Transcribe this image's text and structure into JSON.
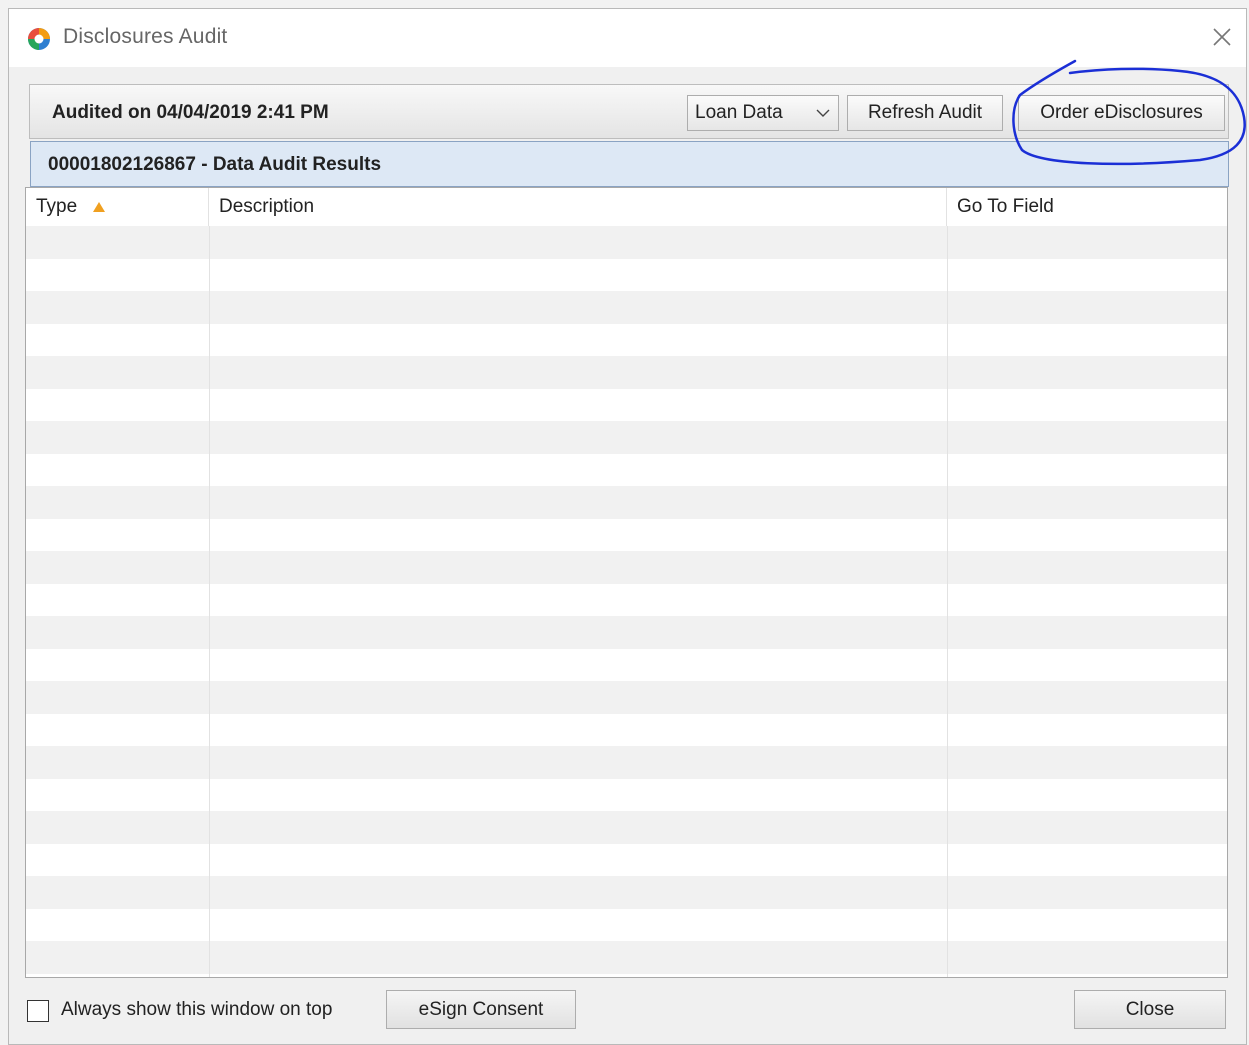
{
  "window": {
    "title": "Disclosures Audit"
  },
  "toolbar": {
    "audited_text": "Audited on 04/04/2019 2:41 PM",
    "loan_select_value": "Loan Data",
    "refresh_label": "Refresh Audit",
    "order_label": "Order eDisclosures"
  },
  "results": {
    "title": "00001802126867 - Data Audit Results",
    "columns": [
      "Type",
      "Description",
      "Go To Field"
    ],
    "sort_column": "Type",
    "sort_direction": "ascending",
    "rows": []
  },
  "footer": {
    "always_on_top_label": "Always show this window on top",
    "always_on_top_checked": false,
    "esign_label": "eSign Consent",
    "close_label": "Close"
  },
  "colors": {
    "accent_sort": "#f0a020",
    "header_band": "#dde8f5",
    "annotation_ink": "#1b2fd6"
  },
  "icons": {
    "app": "app-logo-icon",
    "close": "close-icon",
    "dropdown": "chevron-down-icon",
    "sort": "sort-ascending-icon",
    "checkbox": "checkbox-unchecked"
  }
}
